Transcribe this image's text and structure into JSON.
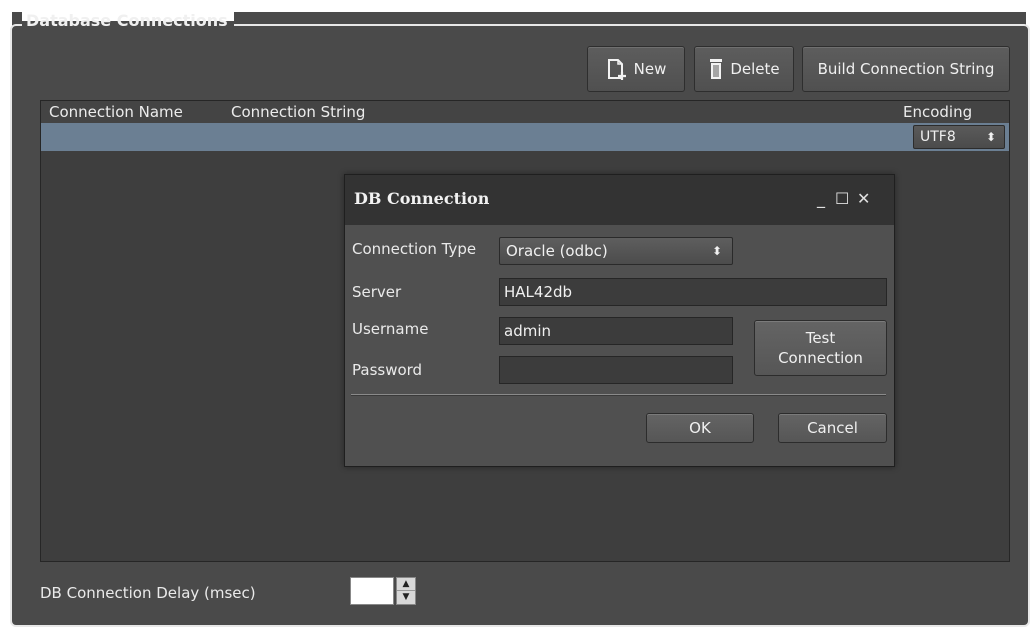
{
  "group": {
    "title": "Database Connections"
  },
  "toolbar": {
    "new_label": "New",
    "delete_label": "Delete",
    "build_label": "Build Connection String"
  },
  "table": {
    "columns": [
      "Connection Name",
      "Connection String",
      "Encoding"
    ],
    "rows": [
      {
        "connection_name": "",
        "connection_string": "",
        "encoding": "UTF8"
      }
    ]
  },
  "dialog": {
    "title": "DB Connection",
    "window_controls": [
      "_",
      "☐",
      "✕"
    ],
    "connection_type_label": "Connection Type",
    "connection_type_value": "Oracle (odbc)",
    "server_label": "Server",
    "server_value": "HAL42db",
    "username_label": "Username",
    "username_value": "admin",
    "password_label": "Password",
    "password_value": "",
    "test_button_line1": "Test",
    "test_button_line2": "Connection",
    "ok_label": "OK",
    "cancel_label": "Cancel"
  },
  "footer": {
    "delay_label": "DB Connection Delay (msec)",
    "delay_value": ""
  },
  "colors": {
    "panel_bg": "#4a4a4a",
    "table_bg": "#3e3e3e",
    "selected_row": "#6b7f93",
    "dialog_bg": "#505050",
    "dialog_titlebar": "#333333"
  },
  "icons": {
    "new": "new-document-icon",
    "delete": "trash-icon",
    "select_arrow": "updown-arrow-icon",
    "spin_up": "spin-up-icon",
    "spin_down": "spin-down-icon"
  }
}
